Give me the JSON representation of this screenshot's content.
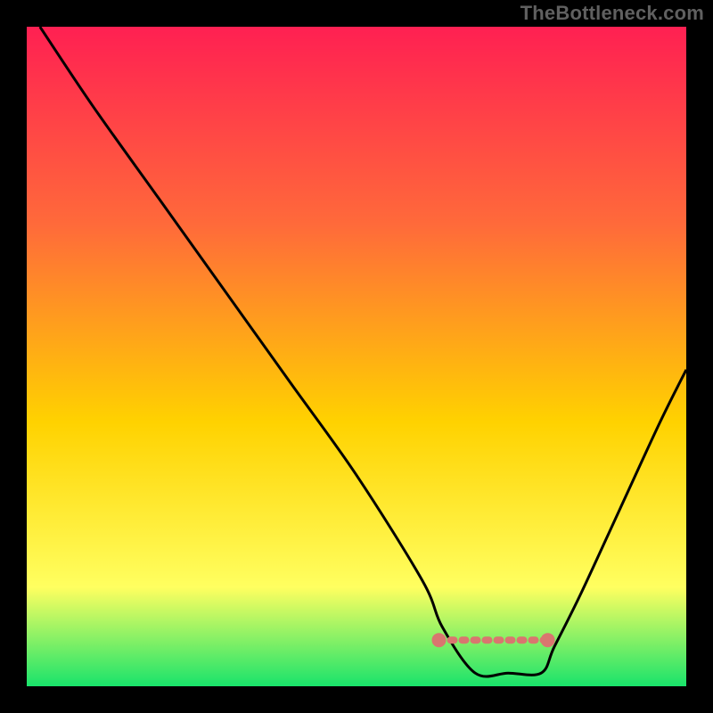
{
  "watermark": "TheBottleneck.com",
  "chart_data": {
    "type": "line",
    "title": "",
    "xlabel": "",
    "ylabel": "",
    "xlim": [
      0,
      100
    ],
    "ylim": [
      0,
      100
    ],
    "grid": false,
    "legend": false,
    "background_gradient": {
      "top": "#ff2052",
      "mid_top": "#ff6a3a",
      "mid": "#ffd200",
      "mid_bottom": "#ffff60",
      "bottom": "#19e36b"
    },
    "series": [
      {
        "name": "bottleneck-curve",
        "color": "#000000",
        "x": [
          2,
          10,
          20,
          30,
          40,
          50,
          60,
          63,
          68,
          73,
          78,
          80,
          84,
          90,
          96,
          100
        ],
        "values": [
          100,
          88,
          74,
          60,
          46,
          32,
          16,
          9,
          2,
          2,
          2,
          6,
          14,
          27,
          40,
          48
        ]
      }
    ],
    "highlight_band": {
      "name": "optimal-range",
      "color": "#d9766f",
      "x_start": 62.5,
      "x_end": 79,
      "y": 7
    }
  }
}
